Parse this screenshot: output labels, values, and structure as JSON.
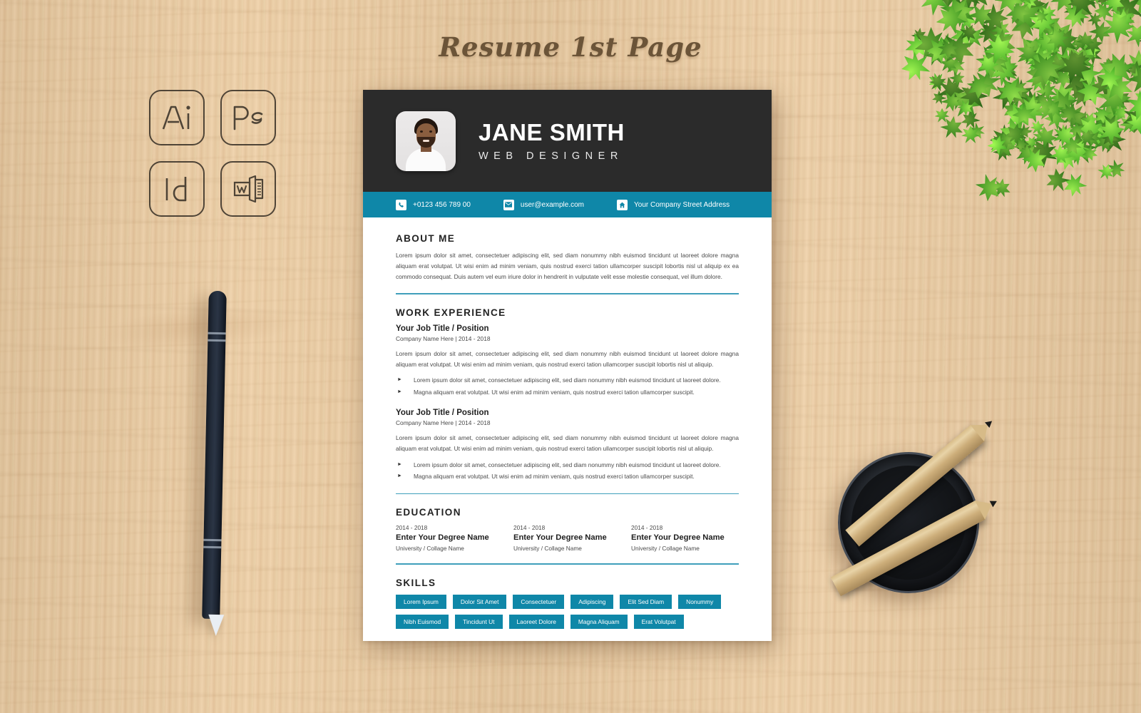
{
  "mockup": {
    "title": "Resume 1st Page",
    "software_badges": [
      {
        "name": "adobe-illustrator-icon",
        "label": "Ai"
      },
      {
        "name": "adobe-photoshop-icon",
        "label": "Ps"
      },
      {
        "name": "adobe-indesign-icon",
        "label": "Id"
      },
      {
        "name": "microsoft-word-icon",
        "label": "W"
      }
    ],
    "props": [
      "stylus-pen",
      "potted-plant",
      "pencil-cup",
      "two-pencils"
    ]
  },
  "colors": {
    "accent": "#0f87a8",
    "header_dark": "#2b2b2b",
    "rule": "#3f9fbb",
    "sheet": "#ffffff",
    "desk_wood": "#e6c79d",
    "title_brown": "#6b5438"
  },
  "resume": {
    "header": {
      "name": "JANE SMITH",
      "role": "WEB DESIGNER",
      "avatar_alt": "profile-photo"
    },
    "contact": [
      {
        "icon": "phone-icon",
        "text": "+0123 456 789 00"
      },
      {
        "icon": "envelope-icon",
        "text": "user@example.com"
      },
      {
        "icon": "home-icon",
        "text": "Your Company Street Address"
      }
    ],
    "about": {
      "heading": "ABOUT ME",
      "text": "Lorem ipsum dolor sit amet, consectetuer adipiscing elit, sed diam nonummy nibh euismod tincidunt ut laoreet dolore magna aliquam erat volutpat. Ut wisi enim ad minim veniam, quis nostrud exerci tation ullamcorper suscipit lobortis nisl ut aliquip ex ea commodo consequat. Duis autem vel eum iriure dolor in hendrerit in vulputate velit esse molestie consequat, vel illum dolore."
    },
    "work": {
      "heading": "WORK EXPERIENCE",
      "entries": [
        {
          "title": "Your Job Title / Position",
          "meta": "Company Name Here | 2014 - 2018",
          "desc": "Lorem ipsum dolor sit amet, consectetuer adipiscing elit, sed diam nonummy nibh euismod tincidunt ut laoreet dolore magna aliquam erat volutpat. Ut wisi enim ad minim veniam, quis nostrud exerci tation ullamcorper suscipit lobortis nisl ut aliquip.",
          "bullets": [
            "Lorem ipsum dolor sit amet, consectetuer adipiscing elit, sed diam nonummy nibh euismod tincidunt ut laoreet dolore.",
            "Magna aliquam erat volutpat. Ut wisi enim ad minim veniam, quis nostrud exerci tation ullamcorper suscipit."
          ]
        },
        {
          "title": "Your Job Title / Position",
          "meta": "Company Name Here | 2014 - 2018",
          "desc": "Lorem ipsum dolor sit amet, consectetuer adipiscing elit, sed diam nonummy nibh euismod tincidunt ut laoreet dolore magna aliquam erat volutpat. Ut wisi enim ad minim veniam, quis nostrud exerci tation ullamcorper suscipit lobortis nisl ut aliquip.",
          "bullets": [
            "Lorem ipsum dolor sit amet, consectetuer adipiscing elit, sed diam nonummy nibh euismod tincidunt ut laoreet dolore.",
            "Magna aliquam erat volutpat. Ut wisi enim ad minim veniam, quis nostrud exerci tation ullamcorper suscipit."
          ]
        }
      ]
    },
    "education": {
      "heading": "EDUCATION",
      "entries": [
        {
          "year": "2014 - 2018",
          "degree": "Enter Your Degree Name",
          "school": "University / Collage Name"
        },
        {
          "year": "2014 - 2018",
          "degree": "Enter Your Degree Name",
          "school": "University / Collage Name"
        },
        {
          "year": "2014 - 2018",
          "degree": "Enter Your Degree Name",
          "school": "University / Collage Name"
        }
      ]
    },
    "skills": {
      "heading": "SKILLS",
      "tags": [
        "Lorem Ipsum",
        "Dolor Sit Amet",
        "Consectetuer",
        "Adipiscing",
        "Elit Sed Diam",
        "Nonummy",
        "Nibh Euismod",
        "Tincidunt Ut",
        "Laoreet Dolore",
        "Magna Aliquam",
        "Erat Volutpat"
      ]
    }
  }
}
